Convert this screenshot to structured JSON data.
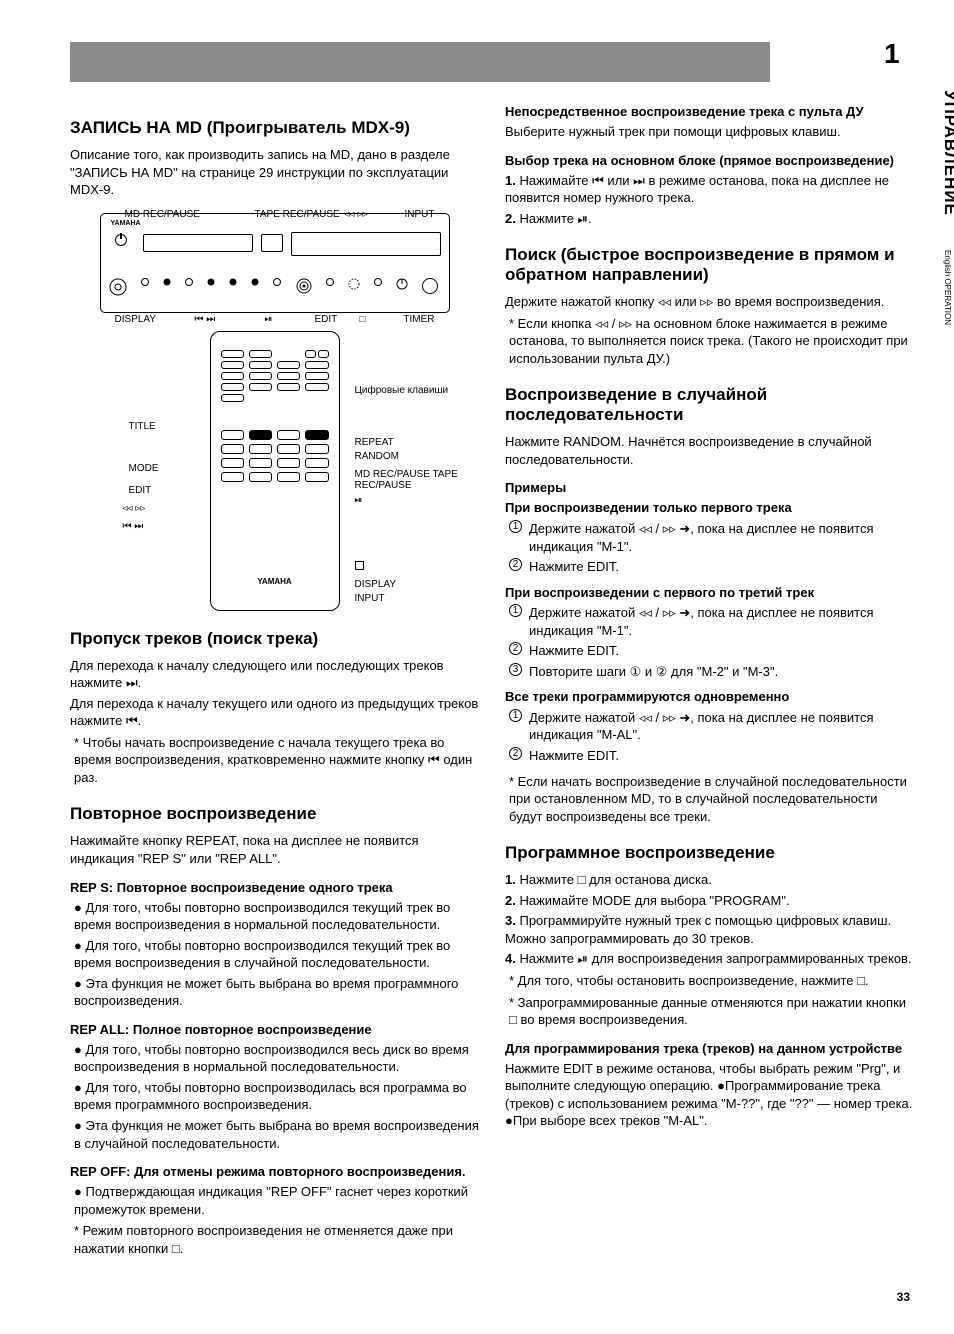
{
  "pageHeader": "1",
  "sideVertical": "УПРАВЛЕНИЕ",
  "sideEnglish": "English OPERATION",
  "pageFooterNum": "33",
  "left": {
    "introTitle": "ЗАПИСЬ НА MD (Проигрыватель MDX-9)",
    "introBody": "Описание того, как производить запись на MD, дано в разделе \"ЗАПИСЬ НА MD\" на странице 29 инструкции по эксплуатации MDX-9.",
    "frontLabels": {
      "mdRecPause": "MD REC/PAUSE",
      "tapeRecPause": "TAPE REC/PAUSE",
      "input": "INPUT",
      "display": "DISPLAY",
      "playPause": "⏯",
      "edit": "EDIT",
      "stop": "□",
      "searchLeft": "◃◃",
      "searchRight": "▹▹",
      "skipLeft": "⏮",
      "skipRight": "⏭"
    },
    "remoteLabelsLeft": {
      "title": "TITLE",
      "mode": "MODE",
      "edit": "EDIT",
      "searchLeft": "◃◃",
      "searchRight": "▹▹",
      "skipLeft": "⏮",
      "skipRight": "⏭"
    },
    "remoteLabelsRight": {
      "numeric": "Цифровые клавиши",
      "repeat": "REPEAT",
      "random": "RANDOM",
      "recPause": "MD REC/PAUSE  TAPE REC/PAUSE",
      "playPause": "⏯",
      "stop": "□",
      "disp": "DISPLAY",
      "input": "INPUT"
    },
    "skipTitle": "Пропуск треков (поиск трека)",
    "skipBody1": "Для перехода к началу следующего или последующих треков нажмите ⏭.",
    "skipBody2": "Для перехода к началу текущего или одного из предыдущих треков нажмите ⏮.",
    "skipNote": "* Чтобы начать воспроизведение с начала текущего трека во время воспроизведения, кратковременно нажмите кнопку ⏮ один раз.",
    "repeatTitle": "Повторное воспроизведение",
    "repeatBody1": "Нажимайте кнопку REPEAT, пока на дисплее не появится индикация \"REP S\" или \"REP ALL\".",
    "repeatSingle": "REP S: Повторное воспроизведение одного трека",
    "repeatItems": [
      "Для того, чтобы повторно воспроизводился текущий трек во время воспроизведения в нормальной последовательности.",
      "Для того, чтобы повторно воспроизводился текущий трек во время воспроизведения в случайной последовательности.",
      "Эта функция не может быть выбрана во время программного воспроизведения."
    ],
    "repeatAll": "REP ALL: Полное повторное воспроизведение",
    "repeatAllItems": [
      "Для того, чтобы повторно воспроизводился весь диск во время воспроизведения в нормальной последовательности.",
      "Для того, чтобы повторно воспроизводилась вся программа во время программного воспроизведения.",
      "Эта функция не может быть выбрана во время воспроизведения в случайной последовательности."
    ],
    "repeatOff": "REP OFF: Для отмены режима повторного воспроизведения.",
    "repeatOffItem": "Подтверждающая индикация \"REP OFF\" гаснет через короткий промежуток времени.",
    "repeatNote": "* Режим повторного воспроизведения не отменяется даже при нажатии кнопки □."
  },
  "right": {
    "skipTitleRemote": "Непосредственное воспроизведение трека с пульта ДУ",
    "skipBodyRemote": "Выберите нужный трек при помощи цифровых клавиш.",
    "selectTitle": "Выбор трека на основном блоке (прямое воспроизведение)",
    "selectSteps": [
      "Нажимайте ⏮ или ⏭ в режиме останова, пока на дисплее не появится номер нужного трека.",
      "Нажмите ⏯."
    ],
    "searchTitle": "Поиск (быстрое воспроизведение в прямом и обратном направлении)",
    "searchBody": "Держите нажатой кнопку ◃◃ или ▹▹ во время воспроизведения.",
    "searchNote": "* Если кнопка ◃◃ / ▹▹ на основном блоке нажимается в режиме останова, то выполняется поиск трека. (Такого не происходит при использовании пульта ДУ.)",
    "randomTitle": "Воспроизведение в случайной последовательности",
    "randomBody": "Нажмите RANDOM. Начнётся воспроизведение в случайной последовательности.",
    "exProgTitle": "Примеры",
    "exProgFirst": {
      "title": "При воспроизведении только первого трека",
      "steps": [
        "Держите нажатой ◃◃ / ▹▹ ➜, пока на дисплее не появится индикация \"M-1\".",
        "Нажмите EDIT."
      ]
    },
    "exProgRange": {
      "title": "При воспроизведении с первого по третий трек",
      "steps": [
        "Держите нажатой ◃◃ / ▹▹ ➜, пока на дисплее не появится индикация \"M-1\".",
        "Нажмите EDIT.",
        "Повторите шаги ① и ② для \"M-2\" и \"M-3\"."
      ]
    },
    "exProgAll": {
      "title": "Все треки программируются одновременно",
      "steps": [
        "Держите нажатой ◃◃ / ▹▹ ➜, пока на дисплее не появится индикация \"M-AL\".",
        "Нажмите EDIT."
      ]
    },
    "randomEndNote": "* Если начать воспроизведение в случайной последовательности при остановленном MD, то в случайной последовательности будут воспроизведены все треки.",
    "progTitle": "Программное воспроизведение",
    "progItems": [
      "Нажмите □ для останова диска.",
      "Нажимайте MODE для выбора \"PROGRAM\".",
      "Программируйте нужный трек с помощью цифровых клавиш. Можно запрограммировать до 30 треков.",
      "Нажмите ⏯ для воспроизведения запрограммированных треков."
    ],
    "progStopNote": "* Для того, чтобы остановить воспроизведение, нажмите □.",
    "progCancelNote": "* Запрограммированные данные отменяются при нажатии кнопки □ во время воспроизведения.",
    "progOnUnitTitle": "Для программирования трека (треков) на данном устройстве",
    "progOnUnitBody": "Нажмите EDIT в режиме останова, чтобы выбрать режим \"Prg\", и выполните следующую операцию. ●Программирование трека (треков) с использованием режима \"M-??\", где \"??\" — номер трека. ●При выборе всех треков \"M-AL\"."
  }
}
